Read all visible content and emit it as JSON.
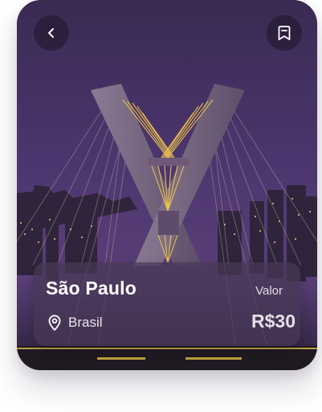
{
  "destination": {
    "city": "São Paulo",
    "country": "Brasil",
    "price_label": "Valor",
    "price": "R$30"
  },
  "icons": {
    "back": "chevron-left-icon",
    "save": "bookmark-icon",
    "location": "location-pin-icon"
  },
  "colors": {
    "sky": "#4a3466",
    "bridge_lights": "#f2c84a",
    "card_overlay": "#483854"
  }
}
